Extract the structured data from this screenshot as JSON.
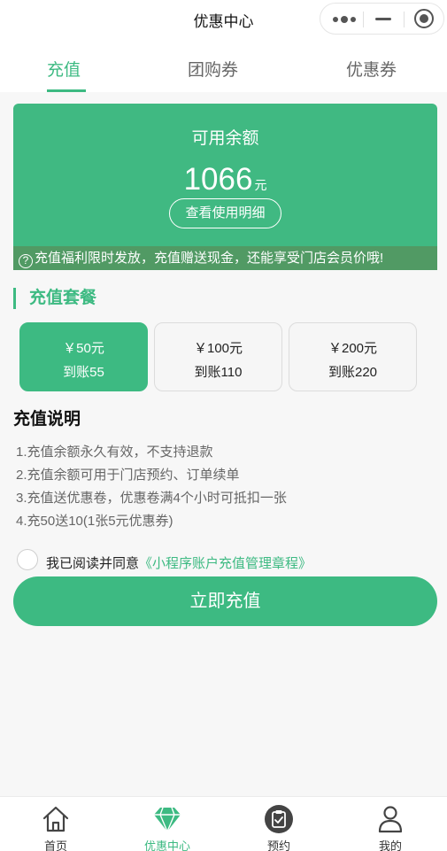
{
  "nav": {
    "title": "优惠中心"
  },
  "tabs": [
    {
      "label": "充值",
      "active": true
    },
    {
      "label": "团购券",
      "active": false
    },
    {
      "label": "优惠券",
      "active": false
    }
  ],
  "balance": {
    "label": "可用余额",
    "amount": "1066",
    "unit": "元",
    "detail_button": "查看使用明细",
    "notice_icon": "?",
    "notice": "充值福利限时发放，充值赠送现金，还能享受门店会员价哦!"
  },
  "packages": {
    "title": "充值套餐",
    "items": [
      {
        "price": "￥50元",
        "got": "到账55",
        "selected": true
      },
      {
        "price": "￥100元",
        "got": "到账110",
        "selected": false
      },
      {
        "price": "￥200元",
        "got": "到账220",
        "selected": false
      }
    ]
  },
  "description": {
    "title": "充值说明",
    "lines": [
      "1.充值余额永久有效，不支持退款",
      "2.充值余额可用于门店预约、订单续单",
      "3.充值送优惠卷，优惠卷满4个小时可抵扣一张",
      "4.充50送10(1张5元优惠券)"
    ]
  },
  "agreement": {
    "text": "我已阅读并同意",
    "link": "《小程序账户充值管理章程》",
    "checked": false
  },
  "submit_label": "立即充值",
  "tabbar": [
    {
      "label": "首页",
      "icon": "home-icon",
      "active": false
    },
    {
      "label": "优惠中心",
      "icon": "diamond-icon",
      "active": true
    },
    {
      "label": "预约",
      "icon": "clipboard-icon",
      "active": false
    },
    {
      "label": "我的",
      "icon": "user-icon",
      "active": false
    }
  ],
  "colors": {
    "accent": "#3dba82",
    "card": "#40b982",
    "notice_bg": "#519a64"
  }
}
